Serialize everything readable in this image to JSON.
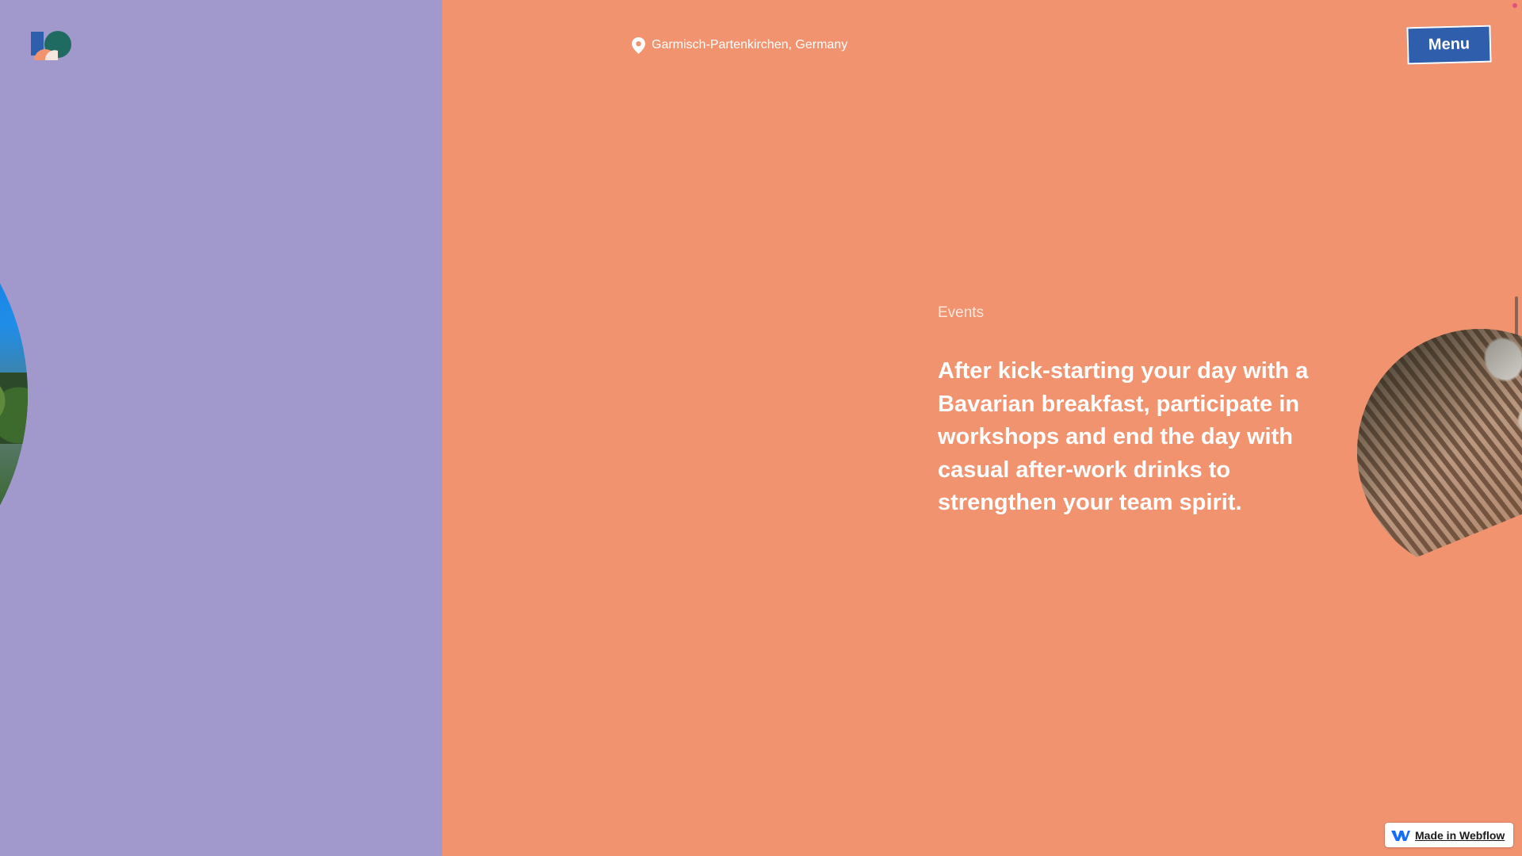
{
  "header": {
    "logo_icon": "studio-logo-icon",
    "location": {
      "icon": "map-pin-icon",
      "text": "Garmisch-Partenkirchen, Germany"
    },
    "menu_label": "Menu"
  },
  "section": {
    "label": "Events",
    "headline": "After kick-starting your day with a Bavarian breakfast, participate in workshops and end the day with casual after-work drinks to strengthen your team spirit."
  },
  "badge": {
    "icon": "webflow-icon",
    "label": "Made in Webflow"
  },
  "colors": {
    "left_panel_bg": "#a199cb",
    "right_panel_bg": "#f29370",
    "menu_button_bg": "#2f5fac",
    "text": "#ffffff"
  }
}
